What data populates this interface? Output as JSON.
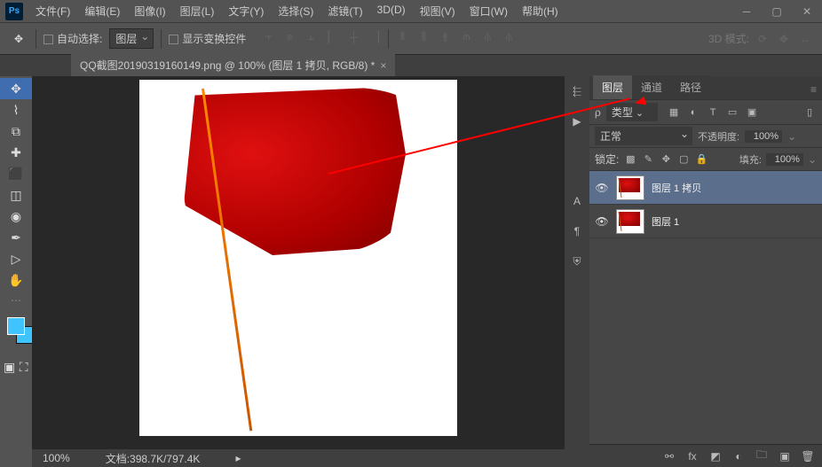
{
  "menu": {
    "file": "文件(F)",
    "edit": "编辑(E)",
    "image": "图像(I)",
    "layer": "图层(L)",
    "type": "文字(Y)",
    "select": "选择(S)",
    "filter": "滤镜(T)",
    "view3d": "3D(D)",
    "view": "视图(V)",
    "window": "窗口(W)",
    "help": "帮助(H)"
  },
  "options": {
    "auto_select": "自动选择:",
    "target": "图层",
    "show_transform": "显示变换控件",
    "mode3d": "3D 模式:"
  },
  "doc": {
    "title": "QQ截图20190319160149.png @ 100% (图层 1 拷贝, RGB/8) *"
  },
  "status": {
    "zoom": "100%",
    "docinfo": "文档:398.7K/797.4K"
  },
  "panels": {
    "layers": "图层",
    "channels": "通道",
    "paths": "路径"
  },
  "layer_panel": {
    "filter_label": "类型",
    "blend_mode": "正常",
    "opacity_label": "不透明度:",
    "opacity_value": "100%",
    "lock_label": "锁定:",
    "fill_label": "填充:",
    "fill_value": "100%",
    "layers": [
      {
        "name": "图层 1 拷贝",
        "visible": true,
        "selected": true
      },
      {
        "name": "图层 1",
        "visible": true,
        "selected": false
      }
    ]
  }
}
